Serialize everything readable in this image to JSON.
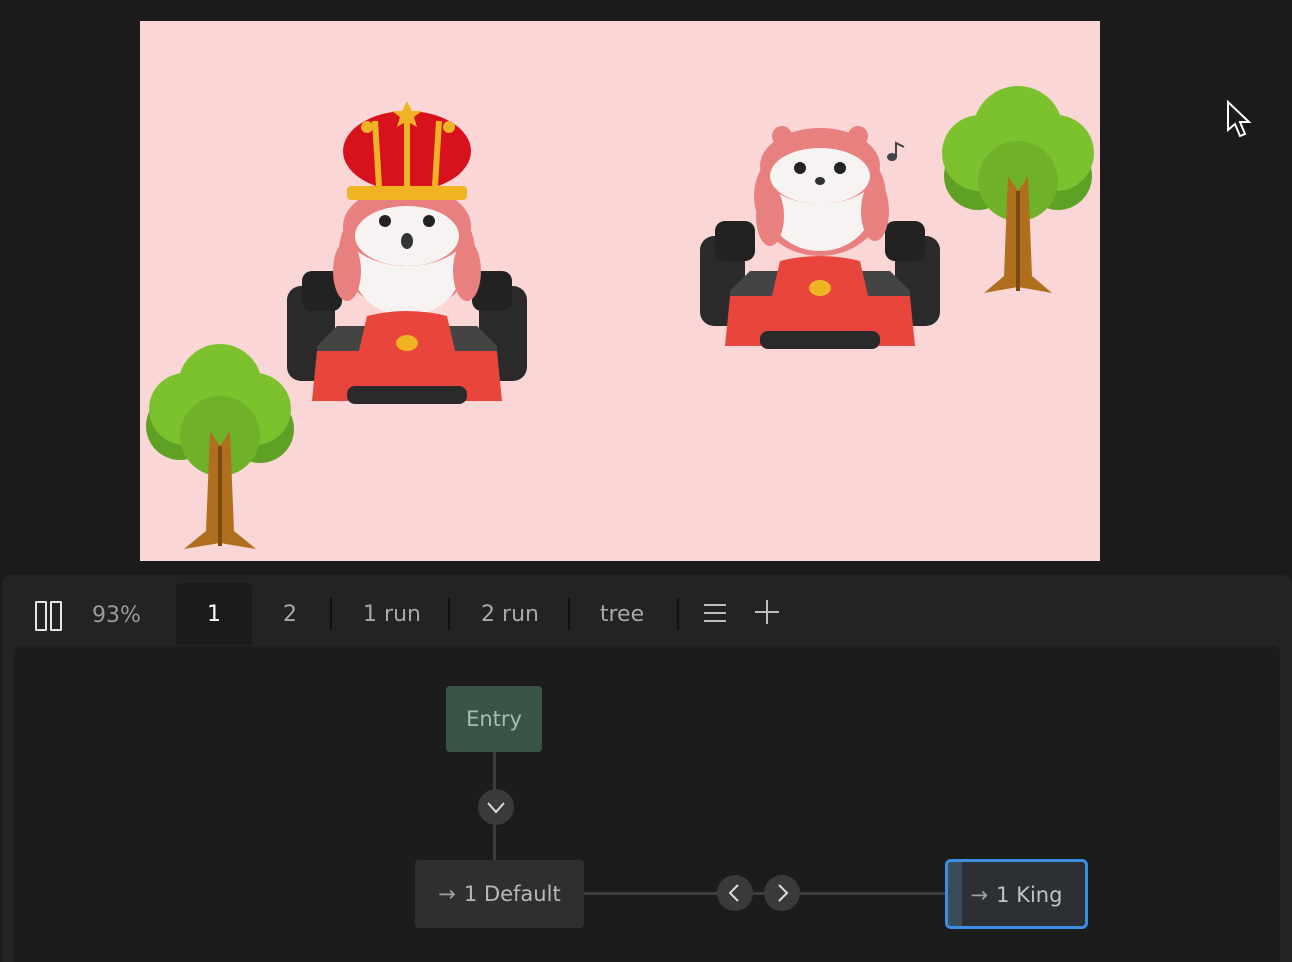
{
  "playback": {
    "zoom": "93%"
  },
  "tabs": [
    {
      "label": "1",
      "active": true
    },
    {
      "label": "2",
      "active": false
    },
    {
      "label": "1 run",
      "active": false
    },
    {
      "label": "2 run",
      "active": false
    },
    {
      "label": "tree",
      "active": false
    }
  ],
  "graph": {
    "entry_label": "Entry",
    "arrow": "→",
    "default_label": "1 Default",
    "king_label": "1 King"
  },
  "icons": [
    "pause-icon",
    "menu-icon",
    "plus-icon",
    "chevron-down-icon",
    "chevron-left-icon",
    "chevron-right-icon",
    "cursor-icon",
    "music-note-icon"
  ],
  "colors": {
    "stage_background": "#fbd6d6",
    "entry_node": "#3a5446",
    "selected_outline": "#3b8ee3",
    "kart_red": "#e8453c",
    "crown_red": "#d8121c",
    "tree_green": "#7cc22f"
  }
}
